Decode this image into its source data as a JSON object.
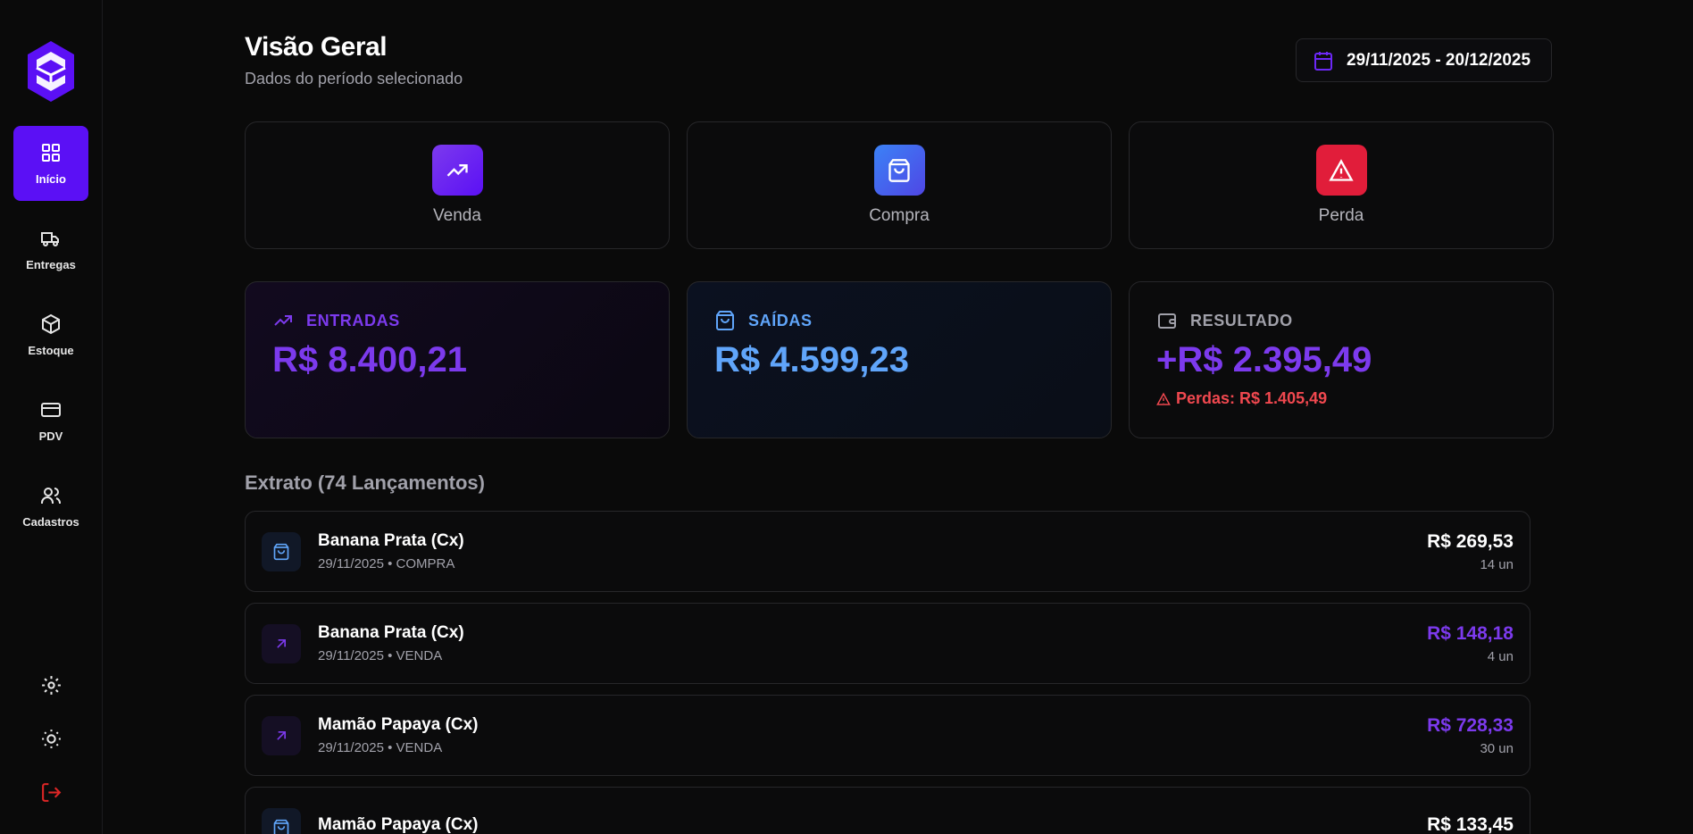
{
  "sidebar": {
    "items": [
      {
        "label": "Início",
        "icon": "grid-icon",
        "active": true
      },
      {
        "label": "Entregas",
        "icon": "truck-icon"
      },
      {
        "label": "Estoque",
        "icon": "box-icon"
      },
      {
        "label": "PDV",
        "icon": "card-icon"
      },
      {
        "label": "Cadastros",
        "icon": "users-icon"
      }
    ],
    "bottom_icons": [
      "gear-icon",
      "sun-icon",
      "logout-icon"
    ]
  },
  "header": {
    "title": "Visão Geral",
    "subtitle": "Dados do período selecionado",
    "date_range": "29/11/2025 - 20/12/2025"
  },
  "actions": [
    {
      "label": "Venda",
      "icon": "trending-up-icon",
      "color": "#6d28f7"
    },
    {
      "label": "Compra",
      "icon": "shopping-bag-icon",
      "color": "#4459f0"
    },
    {
      "label": "Perda",
      "icon": "alert-triangle-icon",
      "color": "#e11d3a"
    }
  ],
  "stats": {
    "entradas": {
      "label": "ENTRADAS",
      "value": "R$ 8.400,21",
      "color": "#7c3aed"
    },
    "saidas": {
      "label": "SAÍDAS",
      "value": "R$ 4.599,23",
      "color": "#60a5fa"
    },
    "resultado": {
      "label": "RESULTADO",
      "value": "+R$ 2.395,49",
      "loss": "Perdas: R$ 1.405,49",
      "color": "#7c3aed"
    }
  },
  "extract": {
    "title": "Extrato (74 Lançamentos)",
    "rows": [
      {
        "name": "Banana Prata (Cx)",
        "meta": "29/11/2025 • COMPRA",
        "amount": "R$ 269,53",
        "qty": "14 un",
        "type": "compra"
      },
      {
        "name": "Banana Prata (Cx)",
        "meta": "29/11/2025 • VENDA",
        "amount": "R$ 148,18",
        "qty": "4 un",
        "type": "venda"
      },
      {
        "name": "Mamão Papaya (Cx)",
        "meta": "29/11/2025 • VENDA",
        "amount": "R$ 728,33",
        "qty": "30 un",
        "type": "venda"
      },
      {
        "name": "Mamão Papaya (Cx)",
        "meta": "",
        "amount": "R$ 133,45",
        "qty": "",
        "type": "compra"
      }
    ]
  }
}
